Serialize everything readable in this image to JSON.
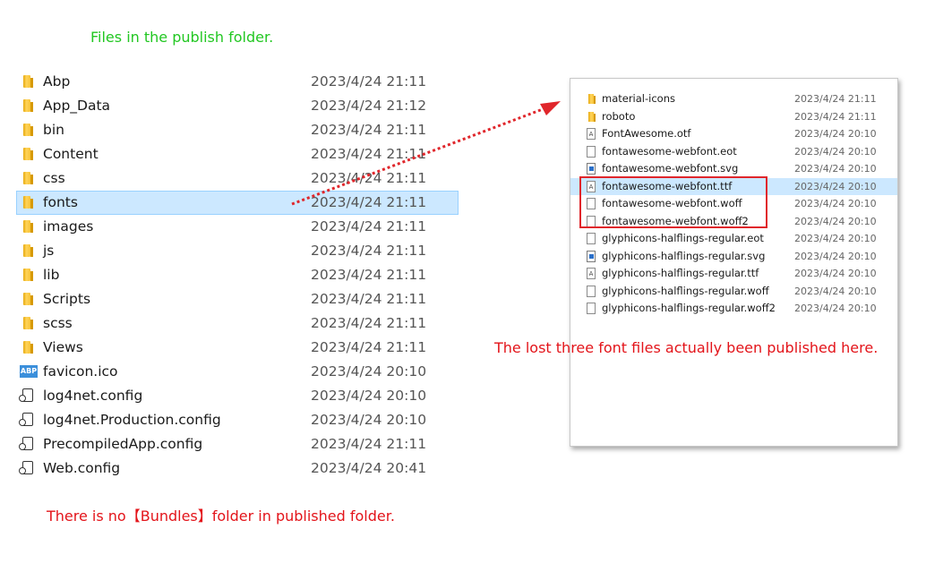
{
  "captions": {
    "top": "Files in the publish folder.",
    "right": "The lost three font files actually been published here.",
    "bottom": "There is no【Bundles】folder in published folder."
  },
  "left_list": [
    {
      "name": "Abp",
      "date": "2023/4/24 21:11",
      "icon": "folder-icon"
    },
    {
      "name": "App_Data",
      "date": "2023/4/24 21:12",
      "icon": "folder-icon"
    },
    {
      "name": "bin",
      "date": "2023/4/24 21:11",
      "icon": "folder-icon"
    },
    {
      "name": "Content",
      "date": "2023/4/24 21:11",
      "icon": "folder-icon"
    },
    {
      "name": "css",
      "date": "2023/4/24 21:11",
      "icon": "folder-icon"
    },
    {
      "name": "fonts",
      "date": "2023/4/24 21:11",
      "icon": "folder-icon",
      "selected": true
    },
    {
      "name": "images",
      "date": "2023/4/24 21:11",
      "icon": "folder-icon"
    },
    {
      "name": "js",
      "date": "2023/4/24 21:11",
      "icon": "folder-icon"
    },
    {
      "name": "lib",
      "date": "2023/4/24 21:11",
      "icon": "folder-icon"
    },
    {
      "name": "Scripts",
      "date": "2023/4/24 21:11",
      "icon": "folder-icon"
    },
    {
      "name": "scss",
      "date": "2023/4/24 21:11",
      "icon": "folder-icon"
    },
    {
      "name": "Views",
      "date": "2023/4/24 21:11",
      "icon": "folder-icon"
    },
    {
      "name": "favicon.ico",
      "date": "2023/4/24 20:10",
      "icon": "abp-icon"
    },
    {
      "name": "log4net.config",
      "date": "2023/4/24 20:10",
      "icon": "config-file-icon"
    },
    {
      "name": "log4net.Production.config",
      "date": "2023/4/24 20:10",
      "icon": "config-file-icon"
    },
    {
      "name": "PrecompiledApp.config",
      "date": "2023/4/24 21:11",
      "icon": "config-file-icon"
    },
    {
      "name": "Web.config",
      "date": "2023/4/24 20:41",
      "icon": "config-file-icon"
    }
  ],
  "right_list": [
    {
      "name": "material-icons",
      "date": "2023/4/24 21:11",
      "icon": "folder-icon"
    },
    {
      "name": "roboto",
      "date": "2023/4/24 21:11",
      "icon": "folder-icon"
    },
    {
      "name": "FontAwesome.otf",
      "date": "2023/4/24 20:10",
      "icon": "font-file-icon"
    },
    {
      "name": "fontawesome-webfont.eot",
      "date": "2023/4/24 20:10",
      "icon": "file-icon"
    },
    {
      "name": "fontawesome-webfont.svg",
      "date": "2023/4/24 20:10",
      "icon": "svg-file-icon"
    },
    {
      "name": "fontawesome-webfont.ttf",
      "date": "2023/4/24 20:10",
      "icon": "font-file-icon",
      "selected": true
    },
    {
      "name": "fontawesome-webfont.woff",
      "date": "2023/4/24 20:10",
      "icon": "file-icon"
    },
    {
      "name": "fontawesome-webfont.woff2",
      "date": "2023/4/24 20:10",
      "icon": "file-icon"
    },
    {
      "name": "glyphicons-halflings-regular.eot",
      "date": "2023/4/24 20:10",
      "icon": "file-icon"
    },
    {
      "name": "glyphicons-halflings-regular.svg",
      "date": "2023/4/24 20:10",
      "icon": "svg-file-icon"
    },
    {
      "name": "glyphicons-halflings-regular.ttf",
      "date": "2023/4/24 20:10",
      "icon": "font-file-icon"
    },
    {
      "name": "glyphicons-halflings-regular.woff",
      "date": "2023/4/24 20:10",
      "icon": "file-icon"
    },
    {
      "name": "glyphicons-halflings-regular.woff2",
      "date": "2023/4/24 20:10",
      "icon": "file-icon"
    }
  ],
  "colors": {
    "caption_green": "#22c722",
    "caption_red": "#e3141a",
    "selection": "#cce8ff",
    "annotation": "#e0262b"
  }
}
